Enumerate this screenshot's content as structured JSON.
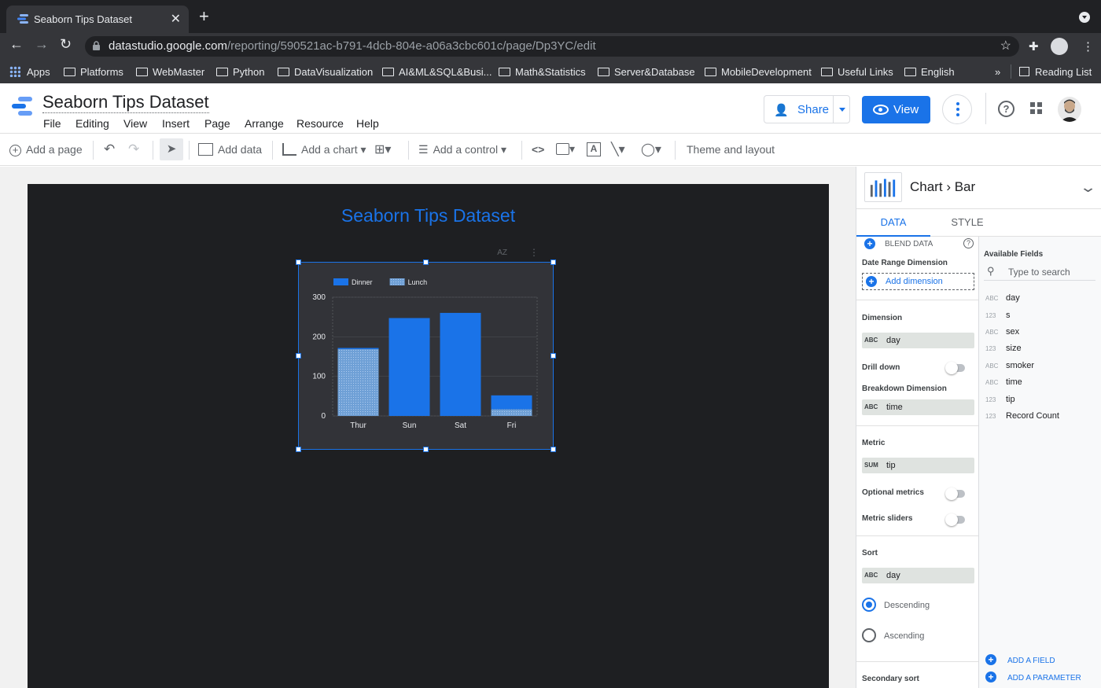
{
  "browser": {
    "tab_title": "Seaborn Tips Dataset",
    "url_host": "datastudio.google.com",
    "url_path": "/reporting/590521ac-b791-4dcb-804e-a06a3cbc601c/page/Dp3YC/edit",
    "bookmarks": [
      "Apps",
      "Platforms",
      "WebMaster",
      "Python",
      "DataVisualization",
      "AI&ML&SQL&Busi...",
      "Math&Statistics",
      "Server&Database",
      "MobileDevelopment",
      "Useful Links",
      "English"
    ],
    "overflow": "»",
    "reading_list": "Reading List"
  },
  "app": {
    "title": "Seaborn Tips Dataset",
    "menu": [
      "File",
      "Editing",
      "View",
      "Insert",
      "Page",
      "Arrange",
      "Resource",
      "Help"
    ],
    "share_label": "Share",
    "view_label": "View",
    "accent": "#1a73e8"
  },
  "toolbar": {
    "add_page": "Add a page",
    "add_data": "Add data",
    "add_chart": "Add a chart",
    "add_control": "Add a control",
    "theme_layout": "Theme and layout"
  },
  "canvas": {
    "page_title": "Seaborn Tips Dataset",
    "page_bg": "#1e1f22",
    "sort_tag": "AZ"
  },
  "chart_data": {
    "type": "bar",
    "categories": [
      "Thur",
      "Sun",
      "Sat",
      "Fri"
    ],
    "series": [
      {
        "name": "Dinner",
        "values": [
          3.0,
          247.4,
          260.4,
          35.3
        ],
        "color": "#1a73e8"
      },
      {
        "name": "Lunch",
        "values": [
          168.8,
          0,
          0,
          16.7
        ],
        "color": "#7aa7d6"
      }
    ],
    "stacked": true,
    "yticks": [
      0,
      100,
      200,
      300
    ],
    "ylim": [
      0,
      300
    ],
    "legend": "top-left",
    "grid": true
  },
  "panel": {
    "breadcrumb_root": "Chart",
    "breadcrumb_leaf": "Bar",
    "tab_data": "DATA",
    "tab_style": "STYLE",
    "blend_data": "BLEND DATA",
    "date_range_label": "Date Range Dimension",
    "add_dimension": "Add dimension",
    "dimension_label": "Dimension",
    "dimension_value": "day",
    "drill_down": "Drill down",
    "breakdown_label": "Breakdown Dimension",
    "breakdown_value": "time",
    "metric_label": "Metric",
    "metric_agg": "SUM",
    "metric_value": "tip",
    "optional_metrics": "Optional metrics",
    "metric_sliders": "Metric sliders",
    "sort_label": "Sort",
    "sort_value": "day",
    "descending": "Descending",
    "ascending": "Ascending",
    "secondary_sort": "Secondary sort",
    "type_abc": "ABC",
    "available_fields": "Available Fields",
    "search_placeholder": "Type to search",
    "fields": [
      {
        "type": "ABC",
        "name": "day"
      },
      {
        "type": "123",
        "name": "s"
      },
      {
        "type": "ABC",
        "name": "sex"
      },
      {
        "type": "123",
        "name": "size"
      },
      {
        "type": "ABC",
        "name": "smoker"
      },
      {
        "type": "ABC",
        "name": "time"
      },
      {
        "type": "123",
        "name": "tip"
      },
      {
        "type": "123",
        "name": "Record Count"
      }
    ],
    "add_field": "ADD A FIELD",
    "add_parameter": "ADD A PARAMETER"
  }
}
